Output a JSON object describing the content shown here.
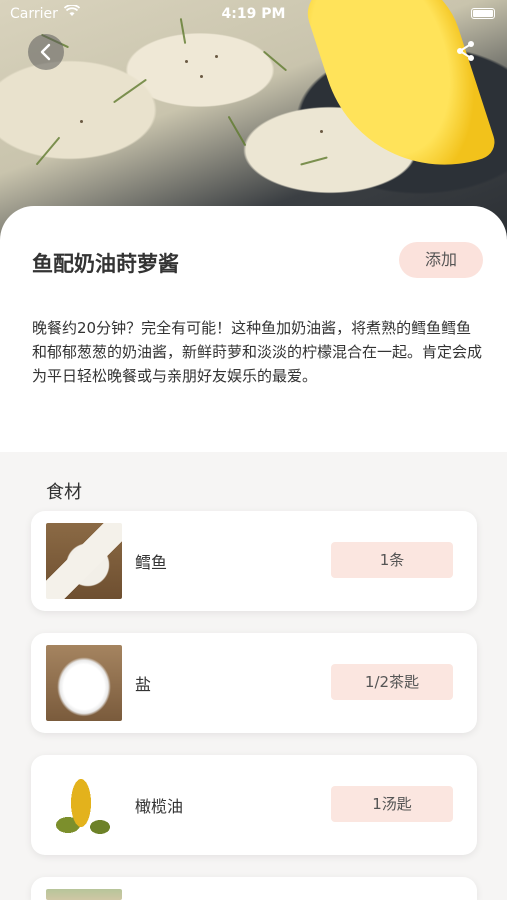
{
  "status_bar": {
    "carrier": "Carrier",
    "time": "4:19 PM"
  },
  "recipe": {
    "title": "鱼配奶油莳萝酱",
    "add_label": "添加",
    "description": "晚餐约20分钟？完全有可能！这种鱼加奶油酱，将煮熟的鳕鱼鳕鱼和郁郁葱葱的奶油酱，新鲜莳萝和淡淡的柠檬混合在一起。肯定会成为平日轻松晚餐或与亲朋好友娱乐的最爱。"
  },
  "ingredients": {
    "title": "食材",
    "items": [
      {
        "name": "鳕鱼",
        "quantity": "1条",
        "icon": "cod-image"
      },
      {
        "name": "盐",
        "quantity": "1/2茶匙",
        "icon": "salt-image"
      },
      {
        "name": "橄榄油",
        "quantity": "1汤匙",
        "icon": "olive-oil-image"
      }
    ]
  },
  "icons": {
    "back": "chevron-left-icon",
    "share": "share-icon",
    "wifi": "wifi-icon",
    "battery": "battery-icon"
  },
  "colors": {
    "accent": "#fbe2dc",
    "background": "#f6f5f4"
  }
}
